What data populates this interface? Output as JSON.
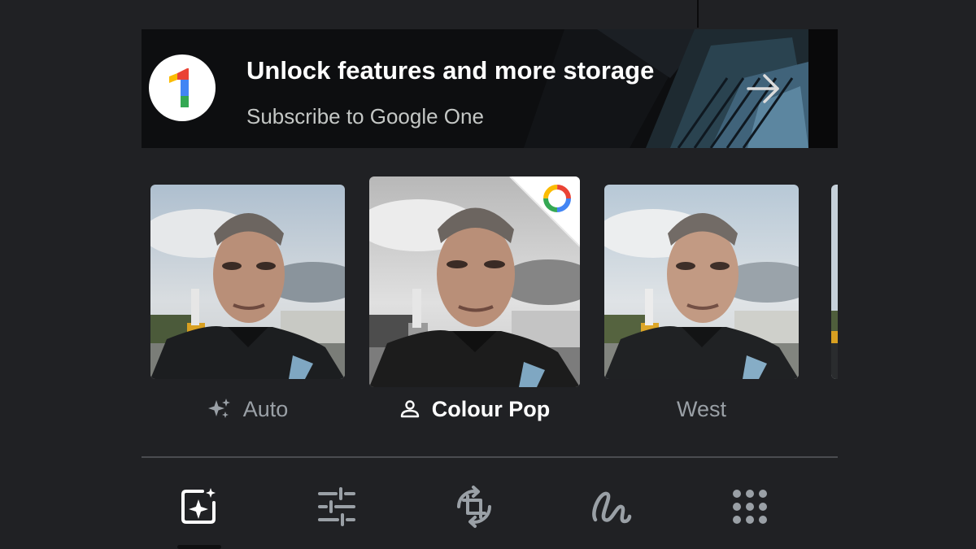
{
  "promo": {
    "title": "Unlock features and more storage",
    "subtitle": "Subscribe to Google One",
    "badge_text": "1",
    "arrow_icon": "arrow-right-icon"
  },
  "filters": [
    {
      "label": "Auto",
      "icon": "sparkle-icon",
      "selected": false
    },
    {
      "label": "Colour Pop",
      "icon": "person-icon",
      "selected": true,
      "badge": "google-one-icon"
    },
    {
      "label": "West",
      "icon": "",
      "selected": false
    }
  ],
  "toolbar": {
    "tools": [
      {
        "name": "suggestions",
        "icon": "auto-enhance-icon",
        "selected": true
      },
      {
        "name": "adjust",
        "icon": "sliders-icon",
        "selected": false
      },
      {
        "name": "crop",
        "icon": "crop-rotate-icon",
        "selected": false
      },
      {
        "name": "markup",
        "icon": "markup-pen-icon",
        "selected": false
      },
      {
        "name": "more",
        "icon": "more-tools-grid-icon",
        "selected": false
      }
    ]
  },
  "colors": {
    "background": "#202124",
    "active_text": "#ffffff",
    "inactive_text": "#9aa0a6",
    "google_blue": "#4285f4",
    "google_red": "#ea4335",
    "google_yellow": "#fbbc04",
    "google_green": "#34a853"
  }
}
